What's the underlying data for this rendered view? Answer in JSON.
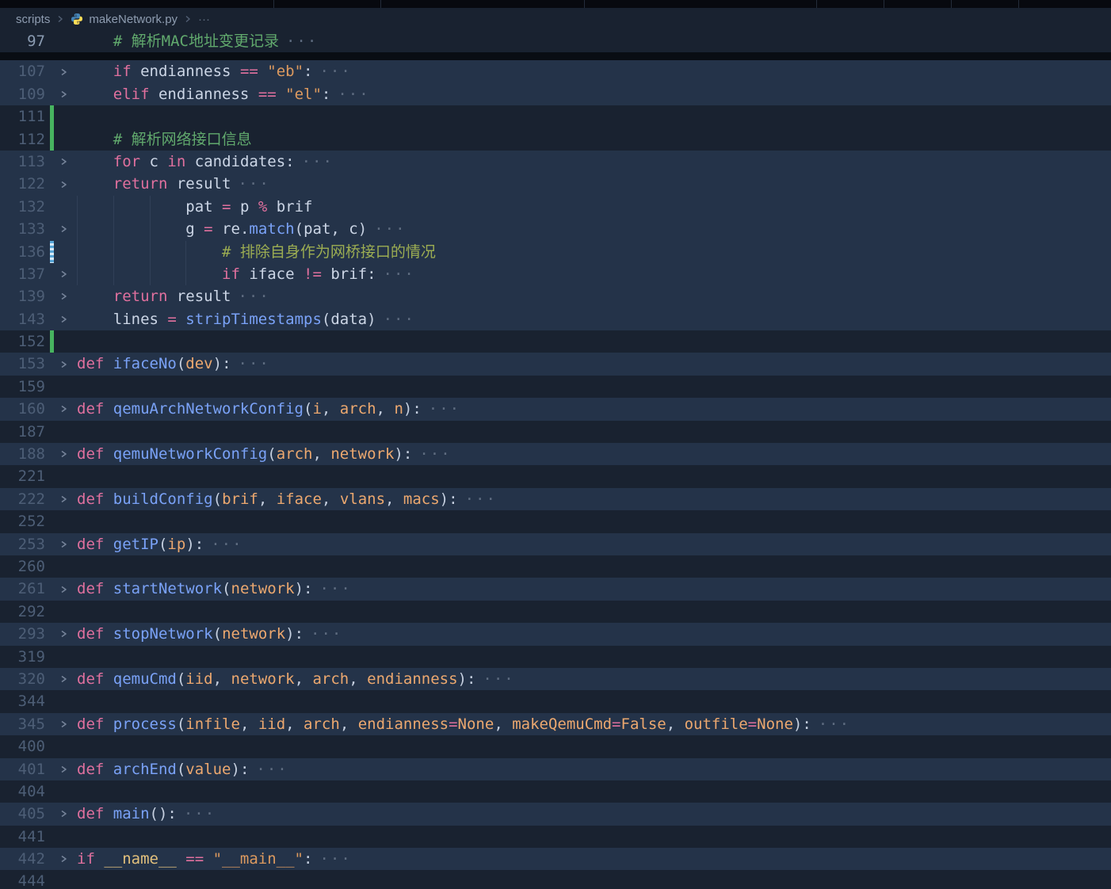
{
  "theme": {
    "bg": "#192230",
    "band": "#243349",
    "tabstrip": "#07090f",
    "shadow": "#090d13",
    "fg": "#ccd6e6",
    "lnum": "#4d5e76",
    "lnum_active": "#8a9bb1",
    "chev": "#76849a",
    "ellipsis": "#5e6c80",
    "kw": "#e0709e",
    "op": "#e0709e",
    "fn": "#7aa2f7",
    "str": "#dd9a5f",
    "pr": "#eca86f",
    "co": "#eca86f",
    "cm": "#61a96d",
    "cm2": "#9cad52",
    "sp": "#e2c07c",
    "pu": "#c6d0e0",
    "guide": "rgba(140,160,190,0.12)",
    "marker_added": "#47b45f",
    "marker_modified": "#58a6d8",
    "breadcrumb_fg": "#8e9cb0"
  },
  "breadcrumb": {
    "items": [
      "scripts",
      "makeNetwork.py",
      "···"
    ],
    "file_icon": "python-icon"
  },
  "editor": {
    "fold_ellipsis": "···",
    "sticky_lines": [
      {
        "num": 97,
        "active": true,
        "indent": 4,
        "tokens": [
          [
            "cm",
            "# 解析MAC地址变更记录"
          ]
        ],
        "ellipsis": true
      }
    ],
    "lines": [
      {
        "num": 107,
        "band": true,
        "chevron": true,
        "ellipsis": true,
        "indent": 4,
        "tokens": [
          [
            "kw",
            "if "
          ],
          [
            "var",
            "endianness "
          ],
          [
            "op",
            "== "
          ],
          [
            "str",
            "\"eb\""
          ],
          [
            "pu",
            ":"
          ]
        ]
      },
      {
        "num": 109,
        "band": true,
        "chevron": true,
        "ellipsis": true,
        "indent": 4,
        "tokens": [
          [
            "kw",
            "elif "
          ],
          [
            "var",
            "endianness "
          ],
          [
            "op",
            "== "
          ],
          [
            "str",
            "\"el\""
          ],
          [
            "pu",
            ":"
          ]
        ]
      },
      {
        "num": 111,
        "marker": "added"
      },
      {
        "num": 112,
        "marker": "added",
        "indent": 4,
        "tokens": [
          [
            "cm",
            "# 解析网络接口信息"
          ]
        ]
      },
      {
        "num": 113,
        "band": true,
        "chevron": true,
        "ellipsis": true,
        "indent": 4,
        "tokens": [
          [
            "kw",
            "for "
          ],
          [
            "var",
            "c "
          ],
          [
            "kw",
            "in "
          ],
          [
            "var",
            "candidates"
          ],
          [
            "pu",
            ":"
          ]
        ]
      },
      {
        "num": 122,
        "band": true,
        "chevron": true,
        "ellipsis": true,
        "indent": 4,
        "tokens": [
          [
            "kw",
            "return "
          ],
          [
            "var",
            "result"
          ]
        ]
      },
      {
        "num": 132,
        "band": true,
        "indent": 12,
        "guides": [
          0,
          4,
          8
        ],
        "tokens": [
          [
            "var",
            "pat "
          ],
          [
            "op",
            "= "
          ],
          [
            "var",
            "p "
          ],
          [
            "op",
            "% "
          ],
          [
            "var",
            "brif"
          ]
        ]
      },
      {
        "num": 133,
        "band": true,
        "chevron": true,
        "ellipsis": true,
        "indent": 12,
        "guides": [
          0,
          4,
          8
        ],
        "tokens": [
          [
            "var",
            "g "
          ],
          [
            "op",
            "= "
          ],
          [
            "var",
            "re"
          ],
          [
            "pu",
            "."
          ],
          [
            "fn",
            "match"
          ],
          [
            "pu",
            "("
          ],
          [
            "var",
            "pat"
          ],
          [
            "pu",
            ", "
          ],
          [
            "var",
            "c"
          ],
          [
            "pu",
            ")"
          ]
        ]
      },
      {
        "num": 136,
        "band": true,
        "marker": "modified",
        "indent": 16,
        "guides": [
          0,
          4,
          8,
          12
        ],
        "tokens": [
          [
            "cm2",
            "# 排除自身作为网桥接口的情况"
          ]
        ]
      },
      {
        "num": 137,
        "band": true,
        "chevron": true,
        "ellipsis": true,
        "indent": 16,
        "guides": [
          0,
          4,
          8,
          12
        ],
        "tokens": [
          [
            "kw",
            "if "
          ],
          [
            "var",
            "iface "
          ],
          [
            "op",
            "!= "
          ],
          [
            "var",
            "brif"
          ],
          [
            "pu",
            ":"
          ]
        ]
      },
      {
        "num": 139,
        "band": true,
        "chevron": true,
        "ellipsis": true,
        "indent": 4,
        "tokens": [
          [
            "kw",
            "return "
          ],
          [
            "var",
            "result"
          ]
        ]
      },
      {
        "num": 143,
        "band": true,
        "chevron": true,
        "ellipsis": true,
        "indent": 4,
        "tokens": [
          [
            "var",
            "lines "
          ],
          [
            "op",
            "= "
          ],
          [
            "fn",
            "stripTimestamps"
          ],
          [
            "pu",
            "("
          ],
          [
            "var",
            "data"
          ],
          [
            "pu",
            ")"
          ]
        ]
      },
      {
        "num": 152,
        "marker": "added"
      },
      {
        "num": 153,
        "band": true,
        "chevron": true,
        "ellipsis": true,
        "tokens": [
          [
            "kw",
            "def "
          ],
          [
            "fn",
            "ifaceNo"
          ],
          [
            "pu",
            "("
          ],
          [
            "pr",
            "dev"
          ],
          [
            "pu",
            "):"
          ]
        ]
      },
      {
        "num": 159
      },
      {
        "num": 160,
        "band": true,
        "chevron": true,
        "ellipsis": true,
        "tokens": [
          [
            "kw",
            "def "
          ],
          [
            "fn",
            "qemuArchNetworkConfig"
          ],
          [
            "pu",
            "("
          ],
          [
            "pr",
            "i"
          ],
          [
            "pu",
            ", "
          ],
          [
            "pr",
            "arch"
          ],
          [
            "pu",
            ", "
          ],
          [
            "pr",
            "n"
          ],
          [
            "pu",
            "):"
          ]
        ]
      },
      {
        "num": 187
      },
      {
        "num": 188,
        "band": true,
        "chevron": true,
        "ellipsis": true,
        "tokens": [
          [
            "kw",
            "def "
          ],
          [
            "fn",
            "qemuNetworkConfig"
          ],
          [
            "pu",
            "("
          ],
          [
            "pr",
            "arch"
          ],
          [
            "pu",
            ", "
          ],
          [
            "pr",
            "network"
          ],
          [
            "pu",
            "):"
          ]
        ]
      },
      {
        "num": 221
      },
      {
        "num": 222,
        "band": true,
        "chevron": true,
        "ellipsis": true,
        "tokens": [
          [
            "kw",
            "def "
          ],
          [
            "fn",
            "buildConfig"
          ],
          [
            "pu",
            "("
          ],
          [
            "pr",
            "brif"
          ],
          [
            "pu",
            ", "
          ],
          [
            "pr",
            "iface"
          ],
          [
            "pu",
            ", "
          ],
          [
            "pr",
            "vlans"
          ],
          [
            "pu",
            ", "
          ],
          [
            "pr",
            "macs"
          ],
          [
            "pu",
            "):"
          ]
        ]
      },
      {
        "num": 252
      },
      {
        "num": 253,
        "band": true,
        "chevron": true,
        "ellipsis": true,
        "tokens": [
          [
            "kw",
            "def "
          ],
          [
            "fn",
            "getIP"
          ],
          [
            "pu",
            "("
          ],
          [
            "pr",
            "ip"
          ],
          [
            "pu",
            "):"
          ]
        ]
      },
      {
        "num": 260
      },
      {
        "num": 261,
        "band": true,
        "chevron": true,
        "ellipsis": true,
        "tokens": [
          [
            "kw",
            "def "
          ],
          [
            "fn",
            "startNetwork"
          ],
          [
            "pu",
            "("
          ],
          [
            "pr",
            "network"
          ],
          [
            "pu",
            "):"
          ]
        ]
      },
      {
        "num": 292
      },
      {
        "num": 293,
        "band": true,
        "chevron": true,
        "ellipsis": true,
        "tokens": [
          [
            "kw",
            "def "
          ],
          [
            "fn",
            "stopNetwork"
          ],
          [
            "pu",
            "("
          ],
          [
            "pr",
            "network"
          ],
          [
            "pu",
            "):"
          ]
        ]
      },
      {
        "num": 319
      },
      {
        "num": 320,
        "band": true,
        "chevron": true,
        "ellipsis": true,
        "tokens": [
          [
            "kw",
            "def "
          ],
          [
            "fn",
            "qemuCmd"
          ],
          [
            "pu",
            "("
          ],
          [
            "pr",
            "iid"
          ],
          [
            "pu",
            ", "
          ],
          [
            "pr",
            "network"
          ],
          [
            "pu",
            ", "
          ],
          [
            "pr",
            "arch"
          ],
          [
            "pu",
            ", "
          ],
          [
            "pr",
            "endianness"
          ],
          [
            "pu",
            "):"
          ]
        ]
      },
      {
        "num": 344
      },
      {
        "num": 345,
        "band": true,
        "chevron": true,
        "ellipsis": true,
        "tokens": [
          [
            "kw",
            "def "
          ],
          [
            "fn",
            "process"
          ],
          [
            "pu",
            "("
          ],
          [
            "pr",
            "infile"
          ],
          [
            "pu",
            ", "
          ],
          [
            "pr",
            "iid"
          ],
          [
            "pu",
            ", "
          ],
          [
            "pr",
            "arch"
          ],
          [
            "pu",
            ", "
          ],
          [
            "pr",
            "endianness"
          ],
          [
            "op",
            "="
          ],
          [
            "co",
            "None"
          ],
          [
            "pu",
            ", "
          ],
          [
            "pr",
            "makeQemuCmd"
          ],
          [
            "op",
            "="
          ],
          [
            "co",
            "False"
          ],
          [
            "pu",
            ", "
          ],
          [
            "pr",
            "outfile"
          ],
          [
            "op",
            "="
          ],
          [
            "co",
            "None"
          ],
          [
            "pu",
            "):"
          ]
        ]
      },
      {
        "num": 400
      },
      {
        "num": 401,
        "band": true,
        "chevron": true,
        "ellipsis": true,
        "tokens": [
          [
            "kw",
            "def "
          ],
          [
            "fn",
            "archEnd"
          ],
          [
            "pu",
            "("
          ],
          [
            "pr",
            "value"
          ],
          [
            "pu",
            "):"
          ]
        ]
      },
      {
        "num": 404
      },
      {
        "num": 405,
        "band": true,
        "chevron": true,
        "ellipsis": true,
        "tokens": [
          [
            "kw",
            "def "
          ],
          [
            "fn",
            "main"
          ],
          [
            "pu",
            "():"
          ]
        ]
      },
      {
        "num": 441
      },
      {
        "num": 442,
        "band": true,
        "chevron": true,
        "ellipsis": true,
        "tokens": [
          [
            "kw",
            "if "
          ],
          [
            "sp",
            "__name__ "
          ],
          [
            "op",
            "== "
          ],
          [
            "str",
            "\"__main__\""
          ],
          [
            "pu",
            ":"
          ]
        ]
      },
      {
        "num": 444,
        "partial": true
      }
    ]
  }
}
